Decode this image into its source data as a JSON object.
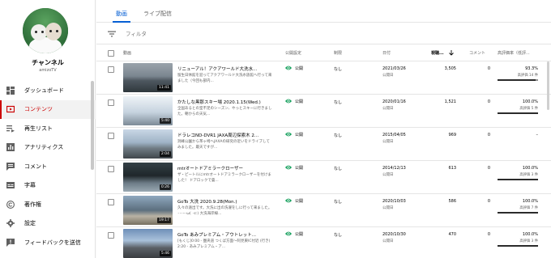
{
  "sidebar": {
    "channel_title": "チャンネル",
    "channel_sub": "amizoTV",
    "items": [
      {
        "label": "ダッシュボード",
        "icon": "dashboard-icon",
        "active": false
      },
      {
        "label": "コンテンツ",
        "icon": "content-icon",
        "active": true
      },
      {
        "label": "再生リスト",
        "icon": "playlist-icon",
        "active": false
      },
      {
        "label": "アナリティクス",
        "icon": "analytics-icon",
        "active": false
      },
      {
        "label": "コメント",
        "icon": "comment-icon",
        "active": false
      },
      {
        "label": "字幕",
        "icon": "subtitles-icon",
        "active": false
      },
      {
        "label": "著作権",
        "icon": "copyright-icon",
        "active": false
      },
      {
        "label": "設定",
        "icon": "gear-icon",
        "active": false
      },
      {
        "label": "フィードバックを送信",
        "icon": "feedback-icon",
        "active": false
      }
    ]
  },
  "tabs": [
    {
      "label": "動画",
      "active": true
    },
    {
      "label": "ライブ配信",
      "active": false
    }
  ],
  "filter": {
    "placeholder": "フィルタ"
  },
  "columns": {
    "video": "動画",
    "visibility": "公開設定",
    "restrictions": "制限",
    "date": "日付",
    "views": "視聴...",
    "comments": "コメント",
    "rating": "高評価率（低評..."
  },
  "colors": {
    "accent": "#065fd4",
    "active_nav": "#cc0000",
    "visibility_icon": "#0f9d58"
  },
  "rows": [
    {
      "title": "リニューアル！アクアワールド大洗水...",
      "desc": "留生日休館を迎ってアクアワールド大洗水族館へ行って来ました（今回も部内...",
      "duration": "11:41",
      "visibility": "公開",
      "restrictions": "なし",
      "date": "2021/03/26",
      "date_sub": "公開日",
      "views": "3,505",
      "comments": "0",
      "rating": "93.3%",
      "rating_sub": "高評価 14 件",
      "rating_frac": 0.933
    },
    {
      "title": "かたしな黒那スキー場 2020.1.15(Wed.)",
      "desc": "全国あるとの室不足のシーズン、やっとスキーに行きました。朝からの天気...",
      "duration": "5:40",
      "visibility": "公開",
      "restrictions": "なし",
      "date": "2020/01/16",
      "date_sub": "公開日",
      "views": "1,521",
      "comments": "0",
      "rating": "100.0%",
      "rating_sub": "高評価 5 件",
      "rating_frac": 1.0
    },
    {
      "title": "ドラレコND-DVR1 JAXA周辺探索木 2...",
      "desc": "洞峰公園から茶ヶ崎へJAXAの研究の近いをドライブしてみました。最天ですが...",
      "duration": "2:04",
      "visibility": "公開",
      "restrictions": "なし",
      "date": "2015/04/05",
      "date_sub": "公開日",
      "views": "969",
      "comments": "0",
      "rating": "–",
      "rating_sub": "",
      "rating_frac": 0
    },
    {
      "title": "mtrオートドアミラークローザー",
      "desc": "ザ・ピートルにmtrオートドアミラークローザーを付けました！ ドアロックで畳...",
      "duration": "0:26",
      "visibility": "公開",
      "restrictions": "なし",
      "date": "2014/12/13",
      "date_sub": "公開日",
      "views": "613",
      "comments": "0",
      "rating": "100.0%",
      "rating_sub": "高評価 3 件",
      "rating_frac": 1.0
    },
    {
      "title": "GoTo 大洗 2020.9.28(Mon.)",
      "desc": "久々の遠出です。大洗に出の洗濯をしに行って来ました。 ･･･ｰ･ω( ･ε:) 大洗海岸線...",
      "duration": "19:17",
      "visibility": "公開",
      "restrictions": "なし",
      "date": "2020/10/03",
      "date_sub": "公開日",
      "views": "586",
      "comments": "0",
      "rating": "100.0%",
      "rating_sub": "高評価 7 件",
      "rating_frac": 1.0
    },
    {
      "title": "GoTo あみプレミアム・アウトレット...",
      "desc": "[もくじ]0:00 - 圏央道 つくば方面〜阿見東IC付近 (行き) 2:20 - あみプレミアム・ア...",
      "duration": "5:46",
      "visibility": "公開",
      "restrictions": "なし",
      "date": "2020/10/30",
      "date_sub": "公開日",
      "views": "470",
      "comments": "0",
      "rating": "100.0%",
      "rating_sub": "高評価 3 件",
      "rating_frac": 1.0
    }
  ]
}
